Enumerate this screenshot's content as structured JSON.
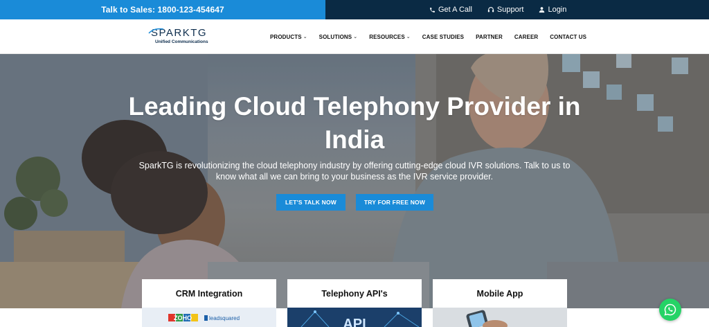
{
  "topbar": {
    "sales_text": "Talk to Sales: 1800-123-454647",
    "get_call": "Get A Call",
    "support": "Support",
    "login": "Login"
  },
  "logo": {
    "name": "SPARKTG",
    "tagline": "Unified Communications"
  },
  "nav": {
    "items": [
      {
        "label": "PRODUCTS",
        "dropdown": true
      },
      {
        "label": "SOLUTIONS",
        "dropdown": true
      },
      {
        "label": "RESOURCES",
        "dropdown": true
      },
      {
        "label": "CASE STUDIES",
        "dropdown": false
      },
      {
        "label": "PARTNER",
        "dropdown": false
      },
      {
        "label": "CAREER",
        "dropdown": false
      },
      {
        "label": "CONTACT US",
        "dropdown": false
      }
    ]
  },
  "hero": {
    "title": "Leading Cloud Telephony Provider in India",
    "subtitle": "SparkTG is revolutionizing the cloud telephony industry by offering cutting-edge cloud IVR solutions. Talk to us to know what all we can bring to your business as the IVR service provider.",
    "cta_talk": "LET'S TALK NOW",
    "cta_try": "TRY FOR FREE NOW"
  },
  "cards": {
    "crm": {
      "title": "CRM Integration",
      "logo_zoho": "ZOHO",
      "logo_lead": "leadsquared"
    },
    "api": {
      "title": "Telephony API's",
      "img_text": "API"
    },
    "mobile": {
      "title": "Mobile App"
    }
  },
  "colors": {
    "primary_blue": "#1a8bd8",
    "dark_navy": "#0a2a44",
    "whatsapp_green": "#25d366"
  }
}
